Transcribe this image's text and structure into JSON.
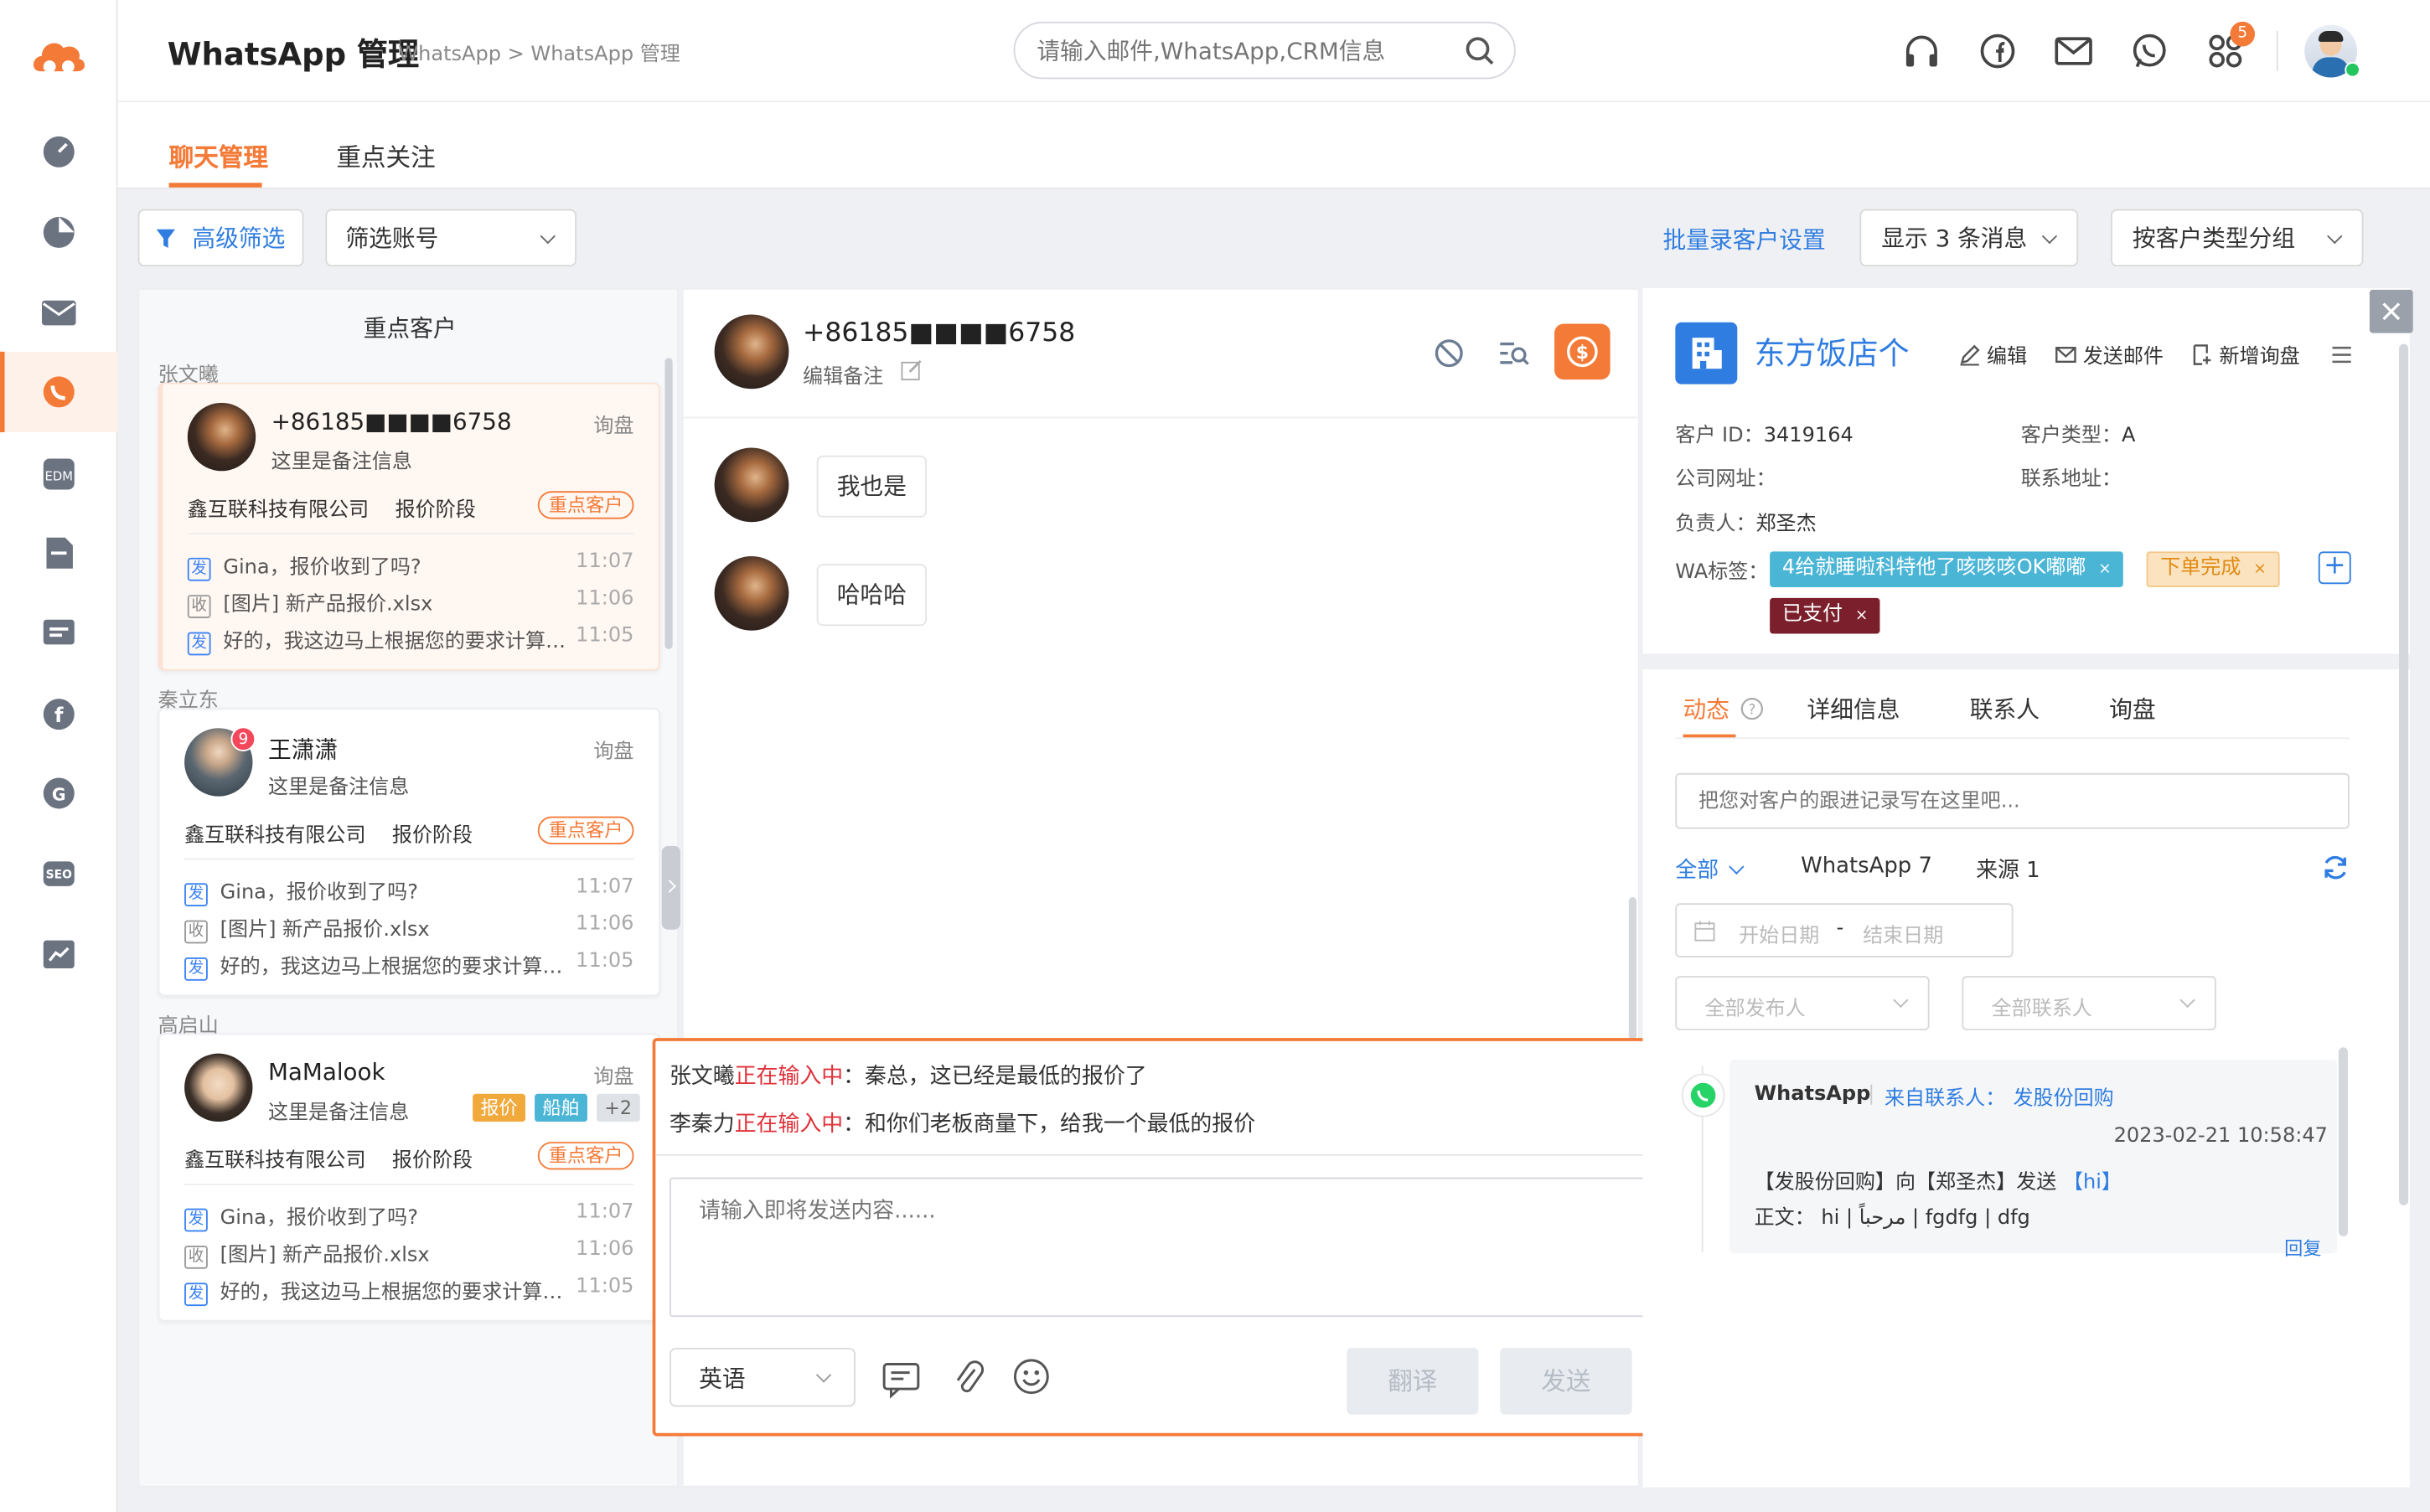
{
  "app": {
    "title": "WhatsApp 管理",
    "breadcrumb": "WhatsApp > WhatsApp 管理"
  },
  "search": {
    "placeholder": "请输入邮件,WhatsApp,CRM信息"
  },
  "header": {
    "notification_count": "5"
  },
  "tabs": [
    {
      "label": "聊天管理",
      "active": true
    },
    {
      "label": "重点关注",
      "active": false
    }
  ],
  "toolbar": {
    "advanced_filter": "高级筛选",
    "account_filter": "筛选账号",
    "batch_setting": "批量录客户设置",
    "show_messages": "显示 3 条消息",
    "group_by": "按客户类型分组"
  },
  "list": {
    "title": "重点客户",
    "groups": [
      {
        "name": "张文曦",
        "contact": "+86185■■■■6758",
        "stage_tag": "询盘",
        "note": "这里是备注信息",
        "company": "鑫互联科技有限公司",
        "stage": "报价阶段",
        "badge": "重点客户",
        "messages": [
          {
            "dir": "发",
            "text": "Gina，报价收到了吗?",
            "time": "11:07"
          },
          {
            "dir": "收",
            "text": "[图片] 新产品报价.xlsx",
            "time": "11:06"
          },
          {
            "dir": "发",
            "text": "好的，我这边马上根据您的要求计算…",
            "time": "11:05"
          }
        ]
      },
      {
        "name": "秦立东",
        "contact": "王潇潇",
        "unread": "9",
        "stage_tag": "询盘",
        "note": "这里是备注信息",
        "company": "鑫互联科技有限公司",
        "stage": "报价阶段",
        "badge": "重点客户",
        "messages": [
          {
            "dir": "发",
            "text": "Gina，报价收到了吗?",
            "time": "11:07"
          },
          {
            "dir": "收",
            "text": "[图片] 新产品报价.xlsx",
            "time": "11:06"
          },
          {
            "dir": "发",
            "text": "好的，我这边马上根据您的要求计算…",
            "time": "11:05"
          }
        ]
      },
      {
        "name": "高启山",
        "contact": "MaMalook",
        "stage_tag": "询盘",
        "note": "这里是备注信息",
        "labels": [
          "报价",
          "船舶",
          "+2"
        ],
        "company": "鑫互联科技有限公司",
        "stage": "报价阶段",
        "badge": "重点客户",
        "messages": [
          {
            "dir": "发",
            "text": "Gina，报价收到了吗?",
            "time": "11:07"
          },
          {
            "dir": "收",
            "text": "[图片] 新产品报价.xlsx",
            "time": "11:06"
          },
          {
            "dir": "发",
            "text": "好的，我这边马上根据您的要求计算…",
            "time": "11:05"
          }
        ]
      }
    ]
  },
  "chat": {
    "contact": "+86185■■■■6758",
    "edit_note": "编辑备注",
    "messages": [
      "我也是",
      "哈哈哈"
    ],
    "typing": [
      {
        "who": "张文曦",
        "status": "正在输入中",
        "text": "：秦总，这已经是最低的报价了"
      },
      {
        "who": "李秦力",
        "status": "正在输入中",
        "text": "：和你们老板商量下，给我一个最低的报价"
      }
    ],
    "input_placeholder": "请输入即将发送内容......",
    "language": "英语",
    "translate": "翻译",
    "send": "发送"
  },
  "customer": {
    "name": "东方饭店个",
    "actions": {
      "edit": "编辑",
      "send_mail": "发送邮件",
      "new_inquiry": "新增询盘"
    },
    "id_label": "客户 ID：",
    "id": "3419164",
    "type_label": "客户类型：",
    "type": "A",
    "website_label": "公司网址：",
    "address_label": "联系地址：",
    "owner_label": "负责人：",
    "owner": "郑圣杰",
    "wa_label": "WA标签：",
    "wa_tags": [
      {
        "text": "4给就睡啦科特他了咳咳咳OK嘟嘟",
        "color": "#4bb5d6"
      },
      {
        "text": "下单完成",
        "color": "#f2a93b"
      },
      {
        "text": "已支付",
        "color": "#7a1f2b"
      }
    ]
  },
  "detail_tabs": [
    "动态",
    "详细信息",
    "联系人",
    "询盘"
  ],
  "activity": {
    "followup_placeholder": "把您对客户的跟进记录写在这里吧...",
    "filter_all": "全部",
    "filter_whatsapp": "WhatsApp 7",
    "filter_source": "来源 1",
    "start_date": "开始日期",
    "date_sep": "-",
    "end_date": "结束日期",
    "publisher": "全部发布人",
    "contact": "全部联系人",
    "item": {
      "channel": "WhatsApp",
      "from_label": "来自联系人：",
      "from": "发股份回购",
      "time": "2023-02-21 10:58:47",
      "line1_prefix": "【发股份回购】向【郑圣杰】发送",
      "line1_link": "【hi】",
      "line2": "正文： hi | مرحباً | fgdfg | dfg",
      "reply": "回复"
    }
  },
  "colors": {
    "accent": "#f47a37",
    "link": "#2f7de1",
    "highlight_border": "#f47a37",
    "typing": "#e0323a"
  }
}
